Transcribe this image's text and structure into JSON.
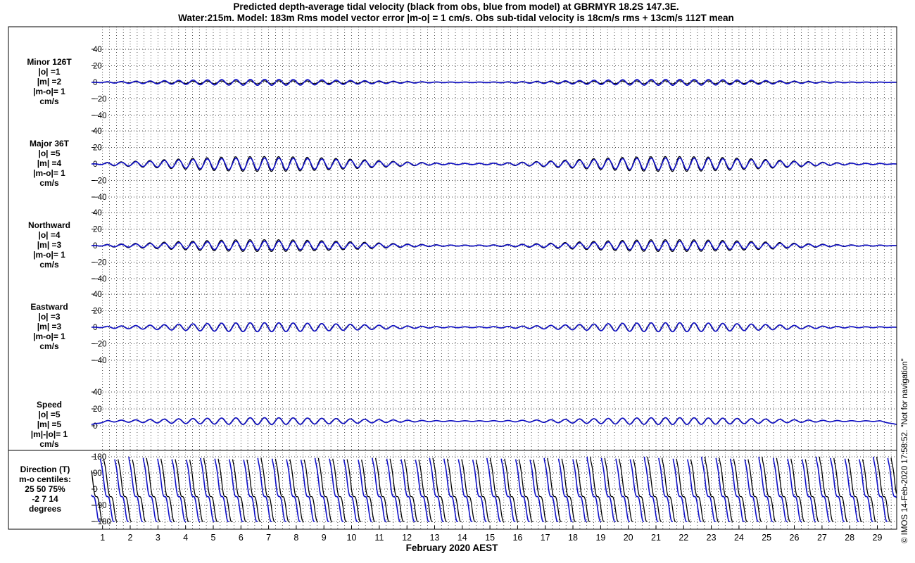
{
  "title": {
    "line1": "Predicted depth-average tidal velocity (black from obs, blue from model) at GBRMYR 18.2S 147.3E.",
    "line2": "Water:215m. Model: 183m  Rms model vector error |m-o| = 1 cm/s. Obs sub-tidal velocity is 18cm/s rms + 13cm/s 112T mean"
  },
  "side_label": "© IMOS 14-Feb-2020 17:58:52. \"Not for navigation\"",
  "colors": {
    "obs": "#000000",
    "model": "#1010c8",
    "grid": "#000000"
  },
  "chart_data": {
    "type": "line",
    "x": {
      "label": "February 2020 AEST",
      "range": [
        0.6,
        29.7
      ],
      "tick_values": [
        1,
        2,
        3,
        4,
        5,
        6,
        7,
        8,
        9,
        10,
        11,
        12,
        13,
        14,
        15,
        16,
        17,
        18,
        19,
        20,
        21,
        22,
        23,
        24,
        25,
        26,
        27,
        28,
        29
      ],
      "tick_labels": [
        "1",
        "2",
        "3",
        "4",
        "5",
        "6",
        "7",
        "8",
        "9",
        "10",
        "11",
        "12",
        "13",
        "14",
        "15",
        "16",
        "17",
        "18",
        "19",
        "20",
        "21",
        "22",
        "23",
        "24",
        "25",
        "26",
        "27",
        "28",
        "29"
      ]
    },
    "series_legend": {
      "obs": "black from obs",
      "model": "blue from model"
    },
    "panels": [
      {
        "id": "minor",
        "label_lines": [
          "Minor 126T",
          "|o| =1",
          "|m| =2",
          "|m-o|= 1",
          "cm/s"
        ],
        "ylim": [
          -40,
          40
        ],
        "yticks": [
          40,
          20,
          0,
          -20,
          -40
        ],
        "ytick_labels": [
          "40",
          "20",
          "0",
          "−20",
          "−40"
        ],
        "amplitude_obs": 1,
        "amplitude_model": 2,
        "mean": 0
      },
      {
        "id": "major",
        "label_lines": [
          "Major 36T",
          "|o| =5",
          "|m| =4",
          "|m-o|= 1",
          "cm/s"
        ],
        "ylim": [
          -40,
          40
        ],
        "yticks": [
          40,
          20,
          0,
          -20,
          -40
        ],
        "ytick_labels": [
          "40",
          "20",
          "0",
          "−20",
          "−40"
        ],
        "amplitude_obs": 5,
        "amplitude_model": 4,
        "mean": 0
      },
      {
        "id": "northward",
        "label_lines": [
          "Northward",
          "|o| =4",
          "|m| =3",
          "|m-o|= 1",
          "cm/s"
        ],
        "ylim": [
          -40,
          40
        ],
        "yticks": [
          40,
          20,
          0,
          -20,
          -40
        ],
        "ytick_labels": [
          "40",
          "20",
          "0",
          "−20",
          "−40"
        ],
        "amplitude_obs": 4,
        "amplitude_model": 3,
        "mean": 0
      },
      {
        "id": "eastward",
        "label_lines": [
          "Eastward",
          "|o| =3",
          "|m| =3",
          "|m-o|= 1",
          "cm/s"
        ],
        "ylim": [
          -40,
          40
        ],
        "yticks": [
          40,
          20,
          0,
          -20,
          -40
        ],
        "ytick_labels": [
          "40",
          "20",
          "0",
          "−20",
          "−40"
        ],
        "amplitude_obs": 3,
        "amplitude_model": 3,
        "mean": 0
      },
      {
        "id": "speed",
        "label_lines": [
          "Speed",
          "|o| =5",
          "|m| =5",
          "|m|-|o|= 1",
          "cm/s"
        ],
        "ylim": [
          0,
          40
        ],
        "yticks": [
          40,
          20,
          0
        ],
        "ytick_labels": [
          "40",
          "20",
          "0"
        ],
        "amplitude_obs": 5,
        "amplitude_model": 5,
        "mean": 0
      },
      {
        "id": "direction",
        "label_lines": [
          "Direction (T)",
          "m-o centiles:",
          "25  50  75%",
          "-2   7  14",
          "degrees"
        ],
        "ylim": [
          -180,
          180
        ],
        "yticks": [
          180,
          90,
          0,
          -90,
          -180
        ],
        "ytick_labels": [
          "180",
          "90",
          "0",
          "−90",
          "−180"
        ],
        "centiles": {
          "p25": -2,
          "p50": 7,
          "p75": 14
        }
      }
    ]
  }
}
